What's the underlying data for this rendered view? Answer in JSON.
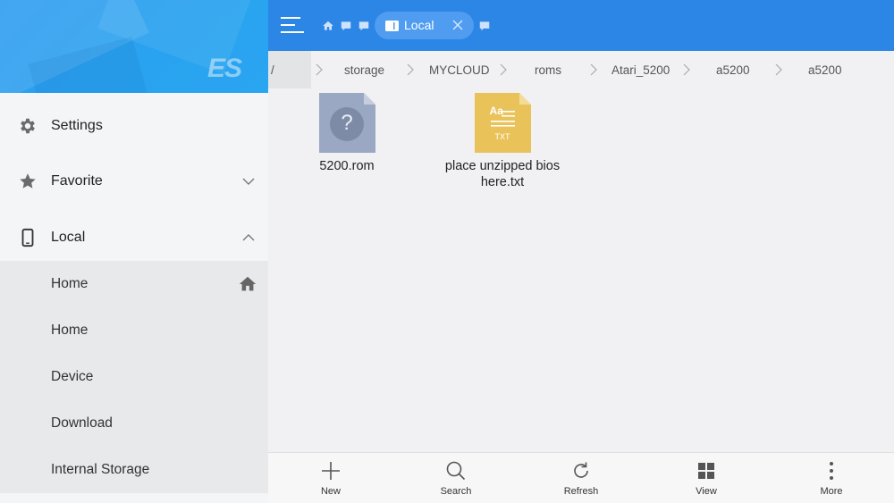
{
  "colors": {
    "accent": "#2b86e6",
    "tab_bg": "#4f9cf0",
    "sidebar_header": "#2f9cf0",
    "unknown_file": "#9aa8c3",
    "txt_file": "#e9c25a"
  },
  "sidebar": {
    "logo": "ES",
    "items": [
      {
        "label": "Settings",
        "icon": "gear-icon"
      },
      {
        "label": "Favorite",
        "icon": "star-icon",
        "chevron": "chevron-down-icon"
      },
      {
        "label": "Local",
        "icon": "phone-icon",
        "chevron": "chevron-up-icon"
      }
    ],
    "local_children": [
      {
        "label": "Home",
        "icon": "home-icon"
      },
      {
        "label": "Home"
      },
      {
        "label": "Device"
      },
      {
        "label": "Download"
      },
      {
        "label": "Internal Storage"
      }
    ]
  },
  "toolbar": {
    "active_tab": "Local"
  },
  "breadcrumb": [
    "/",
    "storage",
    "MYCLOUD",
    "roms",
    "Atari_5200",
    "a5200",
    "a5200"
  ],
  "files": [
    {
      "name": "5200.rom",
      "icon": "unknown-file-icon",
      "glyph": "?"
    },
    {
      "name": "place unzipped bios here.txt",
      "icon": "text-file-icon",
      "glyph_top": "Aa",
      "glyph_bottom": "TXT"
    }
  ],
  "bottom_bar": {
    "new": "New",
    "search": "Search",
    "refresh": "Refresh",
    "view": "View",
    "more": "More"
  }
}
